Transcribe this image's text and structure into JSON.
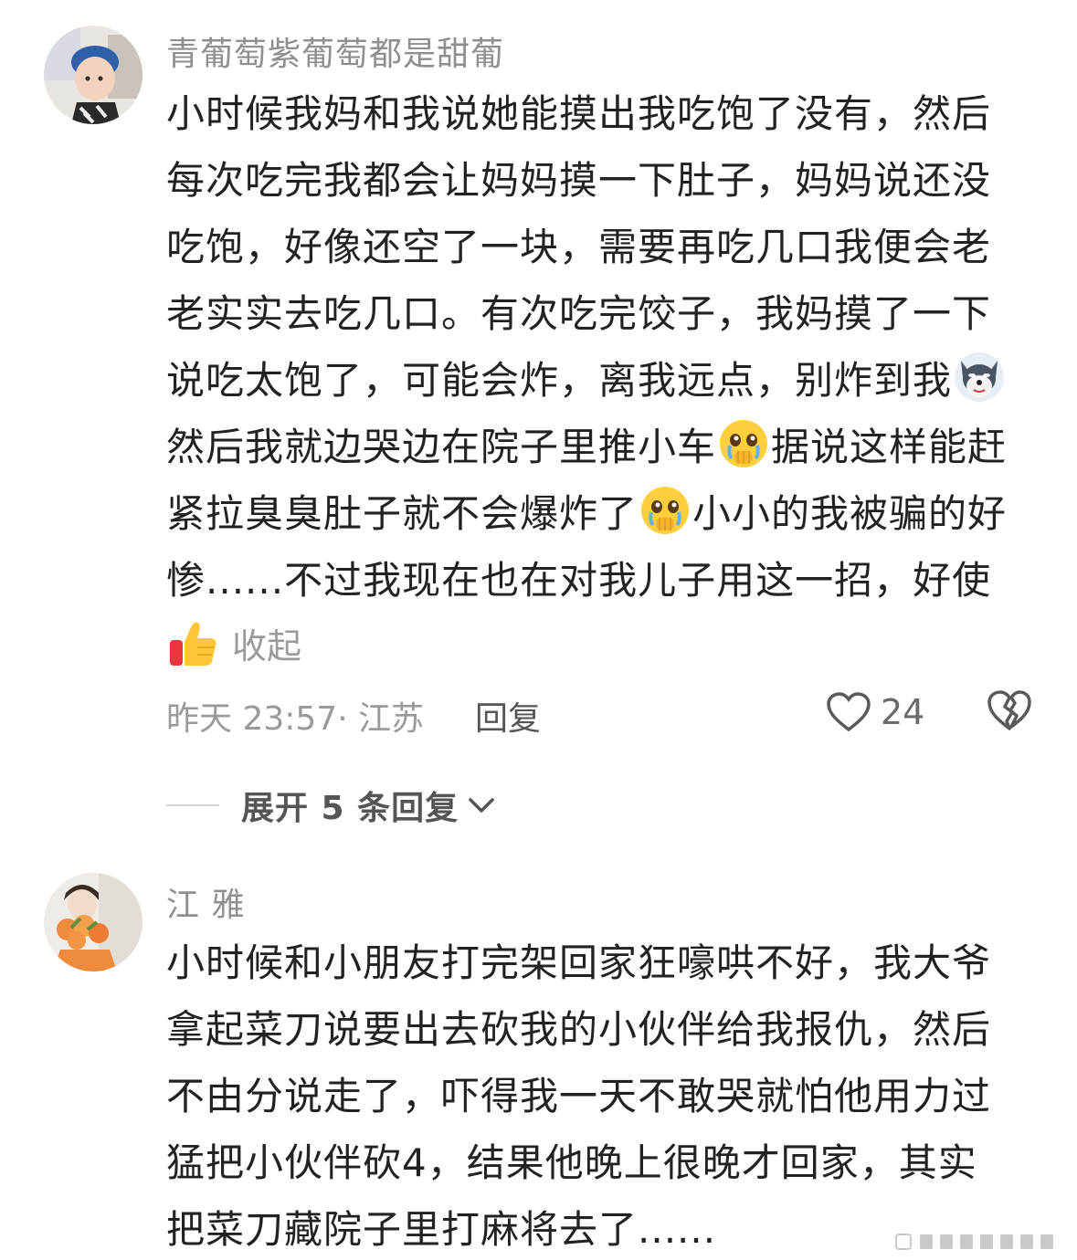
{
  "comments": [
    {
      "username": "青葡萄紫葡萄都是甜葡",
      "lines": [
        "小时候我妈和我说她能摸出我吃饱了没有，然后",
        "每次吃完我都会让妈妈摸一下肚子，妈妈说还没",
        "吃饱，好像还空了一块，需要再吃几口我便会老",
        "老实实去吃几口。有次吃完饺子，我妈摸了一下",
        "说吃太饱了，可能会炸，离我远点，别炸到我",
        "然后我就边哭边在院子里推小车",
        "据说这样能赶",
        "紧拉臭臭肚子就不会爆炸了",
        "小小的我被骗的好",
        "惨......不过我现在也在对我儿子用这一招，好使"
      ],
      "emojis": [
        "doge-icon",
        "crying-face-icon",
        "crying-face-icon",
        "thumbs-up-icon"
      ],
      "collapse_label": "收起",
      "time_location": "昨天 23:57· 江苏",
      "reply_label": "回复",
      "like_count": "24",
      "expand_label": "展开 5 条回复"
    },
    {
      "username": "江  雅",
      "lines": [
        "小时候和小朋友打完架回家狂嚎哄不好，我大爷",
        "拿起菜刀说要出去砍我的小伙伴给我报仇，然后",
        "不由分说走了，吓得我一天不敢哭就怕他用力过",
        "猛把小伙伴砍4，结果他晚上很晚才回家，其实",
        "把菜刀藏院子里打麻将去了......"
      ]
    }
  ],
  "colors": {
    "text": "#222222",
    "meta": "#9a9a9a",
    "username": "#8f8f8f"
  }
}
